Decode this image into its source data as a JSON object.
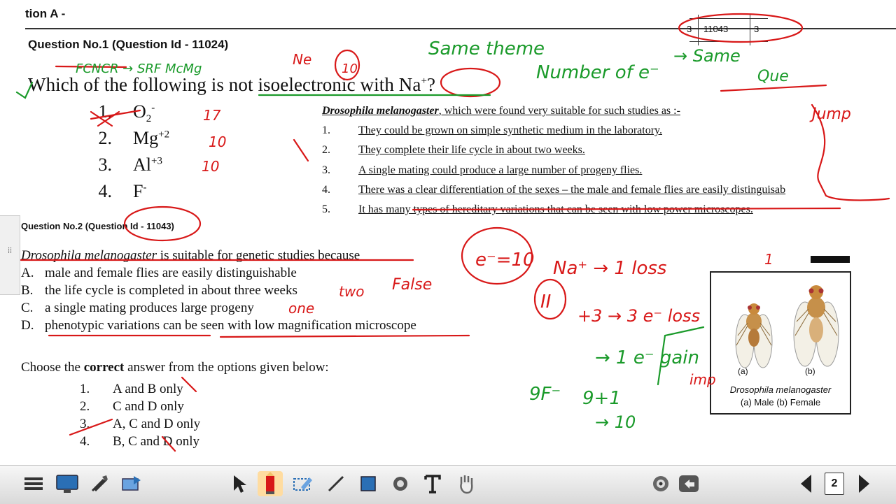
{
  "section_title": "tion A -",
  "q1": {
    "heading": "Question No.1 (Question Id - 11024)",
    "text_prefix": "Which of the following is not isoelectronic with ",
    "ion": "Na",
    "ion_sup": "+",
    "text_suffix": "?",
    "options": [
      {
        "num": "1.",
        "base": "O",
        "sub": "2",
        "sup": "-"
      },
      {
        "num": "2.",
        "base": "Mg",
        "sub": "",
        "sup": "+2"
      },
      {
        "num": "3.",
        "base": "Al",
        "sub": "",
        "sup": "+3"
      },
      {
        "num": "4.",
        "base": "F",
        "sub": "",
        "sup": "-"
      }
    ]
  },
  "right_table": {
    "c1": "3",
    "c2": "11043",
    "c3": "3"
  },
  "drosophila_text": {
    "name": "Drosophila melanogaster",
    "intro": ", which were found very suitable for such studies as :-",
    "items": [
      {
        "num": "1.",
        "text": "They could be grown on simple synthetic medium in the laboratory."
      },
      {
        "num": "2.",
        "text": "They complete their life cycle in about two weeks."
      },
      {
        "num": "3.",
        "text": "A single mating could produce a large number of progeny flies."
      },
      {
        "num": "4.",
        "text": "There was a clear differentiation of the sexes – the male and female flies are easily distinguisab"
      },
      {
        "num": "5.",
        "text": "It has many types of hereditary variations that can be seen with low power microscopes."
      }
    ]
  },
  "q2": {
    "heading": "Question No.2 (Question Id - 11043)",
    "stem_name": "Drosophila melanogaster",
    "stem_rest": " is suitable for genetic studies because",
    "options": [
      {
        "letter": "A.",
        "text": "male and female flies are easily distinguishable"
      },
      {
        "letter": "B.",
        "text": "the life cycle is completed in about three weeks"
      },
      {
        "letter": "C.",
        "text": "a single mating produces large progeny"
      },
      {
        "letter": "D.",
        "text": "phenotypic variations can be seen with low magnification microscope"
      }
    ],
    "choose_prefix": "Choose the ",
    "choose_bold": "correct",
    "choose_suffix": " answer from the options given below:",
    "answers": [
      {
        "num": "1.",
        "text": "A and B only"
      },
      {
        "num": "2.",
        "text": "C and D only"
      },
      {
        "num": "3.",
        "text": "A, C and D only"
      },
      {
        "num": "4.",
        "text": "B, C and D only"
      }
    ]
  },
  "figure": {
    "label_a": "(a)",
    "label_b": "(b)",
    "caption_name": "Drosophila melanogaster",
    "caption_detail": "(a) Male (b) Female"
  },
  "annotations": {
    "ink_red": "#d81818",
    "ink_green": "#1a9a2a",
    "red_texts": [
      "e⁻=10",
      "II",
      "Na⁺ → 1 loss",
      "+3 → 3 e⁻ loss",
      "10",
      "imp",
      "Jump",
      "one",
      "two",
      "False",
      "Ne",
      "17",
      "10",
      "10",
      "1"
    ],
    "green_texts": [
      "Same theme",
      "Number of e⁻",
      "→ Same",
      "9F⁻",
      "→ 1 e⁻ gain",
      "9+1",
      "→ 10",
      "Que",
      "FCNCR → SRF McMg"
    ]
  },
  "toolbar": {
    "page_number": "2",
    "tools": [
      "menu-icon",
      "display-icon",
      "tools-icon",
      "screen-capture-icon",
      "select-arrow-icon",
      "pen-icon",
      "eraser-icon",
      "line-icon",
      "rectangle-icon",
      "fill-icon",
      "text-icon",
      "hand-icon",
      "target-icon",
      "undo-icon",
      "prev-page-icon",
      "page-icon",
      "next-page-icon"
    ]
  }
}
